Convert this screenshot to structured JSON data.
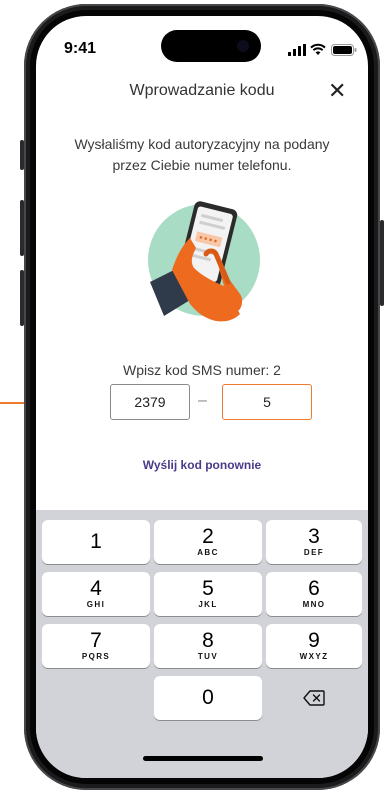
{
  "status_bar": {
    "time": "9:41"
  },
  "header": {
    "title": "Wprowadzanie kodu",
    "close_glyph": "✕"
  },
  "info_text": "Wysłaliśmy kod autoryzacyjny na podany przez Ciebie numer telefonu.",
  "sms": {
    "label": "Wpisz kod SMS numer: 2",
    "code_part1": "2379",
    "separator": "–",
    "code_part2": "5"
  },
  "resend_label": "Wyślij kod ponownie",
  "keypad": {
    "keys": [
      {
        "digit": "1",
        "letters": ""
      },
      {
        "digit": "2",
        "letters": "ABC"
      },
      {
        "digit": "3",
        "letters": "DEF"
      },
      {
        "digit": "4",
        "letters": "GHI"
      },
      {
        "digit": "5",
        "letters": "JKL"
      },
      {
        "digit": "6",
        "letters": "MNO"
      },
      {
        "digit": "7",
        "letters": "PQRS"
      },
      {
        "digit": "8",
        "letters": "TUV"
      },
      {
        "digit": "9",
        "letters": "WXYZ"
      },
      {
        "digit": "0",
        "letters": ""
      }
    ],
    "delete_icon": "backspace-icon"
  },
  "colors": {
    "accent_orange": "#ee7a2d",
    "link_purple": "#4b3a8a",
    "illustration_green": "#a8dcc4"
  }
}
